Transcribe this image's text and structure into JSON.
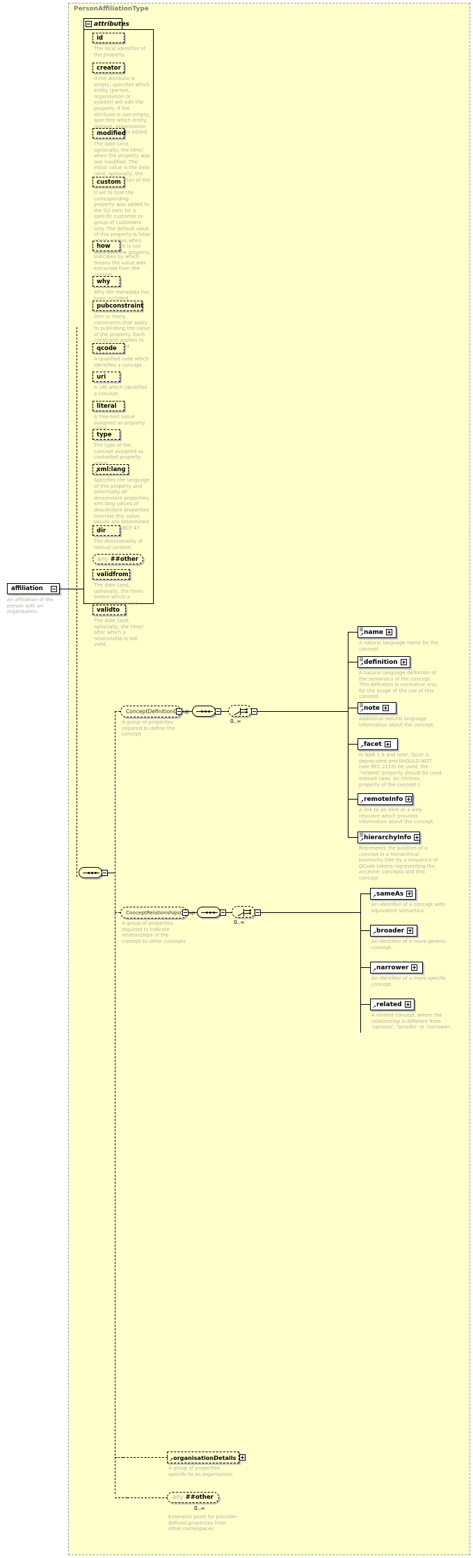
{
  "diagram": {
    "type_name": "PersonAffiliationType",
    "attributes_label": "attributes",
    "root_element": {
      "name": "affiliation",
      "description": "An affiliation of the person with an organisation."
    },
    "attributes": [
      {
        "name": "id",
        "description": "The local identifier of the property."
      },
      {
        "name": "creator",
        "description": "If the attribute is empty, specifies which entity (person, organisation or system) will edit the property. If the attribute is non-empty, specifies which entity (person, organisation or system) has edited the property."
      },
      {
        "name": "modified",
        "description": "The date (and, optionally, the time) when the property was last modified. The initial value is the date (and, optionally, the time) of creation of the property."
      },
      {
        "name": "custom",
        "description": "If set to true the corresponding property was added to the G2 Item for a specific customer or group of customers only. The default value of this property is false which applies when this attribute is not used with the property."
      },
      {
        "name": "how",
        "description": "Indicates by which means the value was extracted from the content."
      },
      {
        "name": "why",
        "description": "Why the metadata has been included."
      },
      {
        "name": "pubconstraint",
        "description": "One or many constraints that apply to publishing the value of the property. Each constraint applies to all descendant elements."
      },
      {
        "name": "qcode",
        "description": "A qualified code which identifies a concept."
      },
      {
        "name": "uri",
        "description": "A URI which identifies a concept."
      },
      {
        "name": "literal",
        "description": "A free-text value assigned as property value."
      },
      {
        "name": "type",
        "description": "The type of the concept assigned as controlled property value."
      },
      {
        "name": "xml:lang",
        "description": "Specifies the language of this property and potentially all descendant properties. xml:lang values of descendant properties override this value. Values are determined by Internet BCP 47."
      },
      {
        "name": "dir",
        "description": "The directionality of textual content."
      },
      {
        "name": "any ##other",
        "any": true,
        "description": ""
      },
      {
        "name": "validfrom",
        "description": "The date (and, optionally, the time) before which a relationship is not valid."
      },
      {
        "name": "validto",
        "description": "The date (and, optionally, the time) after which a relationship is not valid."
      }
    ],
    "groups": [
      {
        "name": "ConceptDefinitionGroup",
        "description": "A group of properites required to define the concept",
        "occurs": "0..∞",
        "children": [
          {
            "name": "name",
            "description": "A natural language name for the concept."
          },
          {
            "name": "definition",
            "description": "A natural language definition of the semantics of the concept. This definition is normative only for the scope of the use of this concept."
          },
          {
            "name": "note",
            "description": "Additional natural language information about the concept."
          },
          {
            "name": "facet",
            "description": "In NAR 1.8 and later, facet is deprecated and SHOULD NOT (see RFC 2119) be used, the \"related\" property should be used instead (was: An intrinsic property of the concept.)"
          },
          {
            "name": "remoteInfo",
            "description": "A link to an item or a web resource which provides information about the concept"
          },
          {
            "name": "hierarchyInfo",
            "description": "Represents the position of a concept in a hierarchical taxonomy tree by a sequence of QCode tokens representing the ancestor concepts and this concept"
          }
        ]
      },
      {
        "name": "ConceptRelationshipsGroup",
        "description": "A group of properties required to indicate relationships of the concept to other concepts",
        "occurs": "0..∞",
        "children": [
          {
            "name": "sameAs",
            "description": "An identifier of a concept with equivalent semantics"
          },
          {
            "name": "broader",
            "description": "An identifier of a more generic concept."
          },
          {
            "name": "narrower",
            "description": "An identifier of a more specific concept."
          },
          {
            "name": "related",
            "description": "A related concept, where the relationship is different from 'sameAs', 'broader' or 'narrower'."
          }
        ]
      }
    ],
    "extra_nodes": [
      {
        "name": "organisationDetails",
        "description": "A group of properties specific to an organisation"
      },
      {
        "name": "any ##other",
        "occurs": "0..∞",
        "description": "Extension point for provider-defined properties from other namespaces"
      }
    ],
    "colors": {
      "type_background": "#ffffcc",
      "node_background": "#ffffff",
      "description_text": "#b0b0a0",
      "title_text": "#808080",
      "line": "#000000",
      "shadow": "#c0c0c0"
    }
  }
}
